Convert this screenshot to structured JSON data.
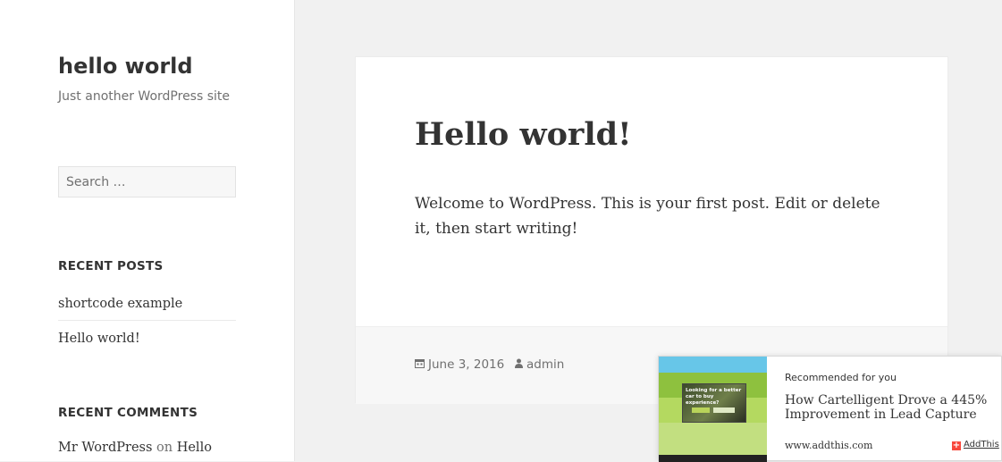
{
  "site": {
    "title": "hello world",
    "description": "Just another WordPress site"
  },
  "search": {
    "placeholder": "Search …"
  },
  "recent_posts": {
    "heading": "RECENT POSTS",
    "items": [
      {
        "label": "shortcode example"
      },
      {
        "label": "Hello world!"
      }
    ]
  },
  "recent_comments": {
    "heading": "RECENT COMMENTS",
    "items": [
      {
        "author": "Mr WordPress",
        "on": "on",
        "post": "Hello"
      }
    ]
  },
  "post": {
    "title": "Hello world!",
    "body": "Welcome to WordPress. This is your first post. Edit or delete it, then start writing!",
    "date": "June 3, 2016",
    "author": "admin",
    "date_icon": "calendar-icon",
    "author_icon": "user-icon"
  },
  "recommendation": {
    "label": "Recommended for you",
    "title": "How Cartelligent Drove a 445% Improvement in Lead Capture",
    "domain": "www.addthis.com",
    "brand": "AddThis",
    "thumbnail_text": "Looking for a better car to buy experience?",
    "brand_color": "#f8483c"
  }
}
